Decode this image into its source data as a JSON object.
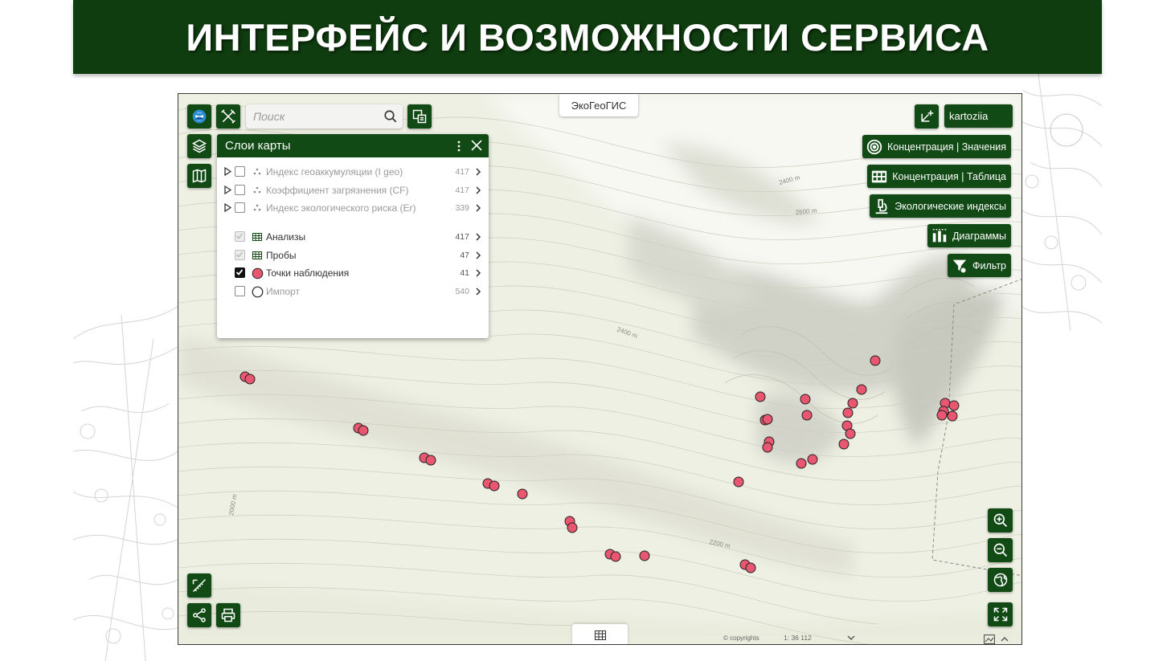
{
  "slide": {
    "title": "ИНТЕРФЕЙС И ВОЗМОЖНОСТИ СЕРВИСА"
  },
  "toolbar": {
    "search_placeholder": "Поиск",
    "app_title": "ЭкоГеоГИС",
    "user": "kartoziia"
  },
  "right_buttons": [
    {
      "label": "Концентрация | Значения",
      "icon": "concentration-target-icon"
    },
    {
      "label": "Концентрация | Таблица",
      "icon": "grid-table-icon"
    },
    {
      "label": "Экологические индексы",
      "icon": "microscope-icon"
    },
    {
      "label": "Диаграммы",
      "icon": "bar-chart-icon"
    },
    {
      "label": "Фильтр",
      "icon": "filter-icon"
    }
  ],
  "layers_panel": {
    "title": "Слои карты",
    "layers": [
      {
        "name": "Индекс геоаккумуляции (I geo)",
        "count": "417",
        "expandable": true,
        "checked": false,
        "state": "inactive",
        "icon": "points-icon"
      },
      {
        "name": "Коэффициент загрязнения (CF)",
        "count": "417",
        "expandable": true,
        "checked": false,
        "state": "inactive",
        "icon": "points-icon"
      },
      {
        "name": "Индекс экологического риска (Er)",
        "count": "339",
        "expandable": true,
        "checked": false,
        "state": "inactive",
        "icon": "points-icon"
      },
      {
        "name": "Анализы",
        "count": "417",
        "expandable": false,
        "checked": false,
        "state": "disabled",
        "icon": "table-icon"
      },
      {
        "name": "Пробы",
        "count": "47",
        "expandable": false,
        "checked": false,
        "state": "disabled",
        "icon": "table-icon"
      },
      {
        "name": "Точки наблюдения",
        "count": "41",
        "expandable": false,
        "checked": true,
        "state": "active",
        "icon": "red-circle-icon"
      },
      {
        "name": "Импорт",
        "count": "540",
        "expandable": false,
        "checked": false,
        "state": "inactive",
        "icon": "empty-circle-icon"
      }
    ]
  },
  "map": {
    "contour_labels": [
      "2400 m",
      "2600 m",
      "2400 m",
      "2200 m",
      "2000 m"
    ],
    "copyright": "© copyrights",
    "scale": "1: 36 112"
  },
  "colors": {
    "brand_green": "#114a14",
    "banner_green": "#0f3d0f",
    "marker_fill": "#e8566f",
    "map_bg": "#eef0e4"
  }
}
